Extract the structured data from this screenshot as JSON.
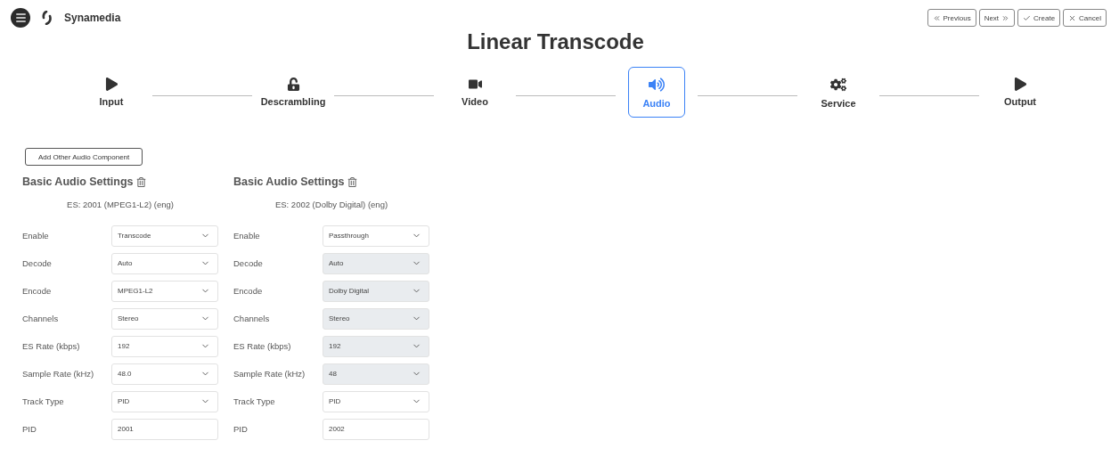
{
  "header": {
    "brand": "Synamedia",
    "buttons": [
      {
        "kind": "previous",
        "label": "Previous"
      },
      {
        "kind": "next",
        "label": "Next"
      },
      {
        "kind": "create",
        "label": "Create"
      },
      {
        "kind": "cancel",
        "label": "Cancel"
      }
    ]
  },
  "title": "Linear Transcode",
  "steps": [
    {
      "kind": "input",
      "label": "Input",
      "selected": false
    },
    {
      "kind": "descrambling",
      "label": "Descrambling",
      "selected": false
    },
    {
      "kind": "video",
      "label": "Video",
      "selected": false
    },
    {
      "kind": "audio",
      "label": "Audio",
      "selected": true
    },
    {
      "kind": "service",
      "label": "Service",
      "selected": false
    },
    {
      "kind": "output",
      "label": "Output",
      "selected": false
    }
  ],
  "add_button": "Add Other Audio Component",
  "components": [
    {
      "title": "Basic Audio Settings",
      "es": "ES: 2001 (MPEG1-L2) (eng)",
      "fields": [
        {
          "label": "Enable",
          "kind": "select",
          "value": "Transcode",
          "disabled": false
        },
        {
          "label": "Decode",
          "kind": "select",
          "value": "Auto",
          "disabled": false
        },
        {
          "label": "Encode",
          "kind": "select",
          "value": "MPEG1-L2",
          "disabled": false
        },
        {
          "label": "Channels",
          "kind": "select",
          "value": "Stereo",
          "disabled": false
        },
        {
          "label": "ES Rate (kbps)",
          "kind": "select",
          "value": "192",
          "disabled": false
        },
        {
          "label": "Sample Rate (kHz)",
          "kind": "select",
          "value": "48.0",
          "disabled": false
        },
        {
          "label": "Track Type",
          "kind": "select",
          "value": "PID",
          "disabled": false
        },
        {
          "label": "PID",
          "kind": "input",
          "value": "2001",
          "disabled": false
        }
      ]
    },
    {
      "title": "Basic Audio Settings",
      "es": "ES: 2002 (Dolby Digital) (eng)",
      "fields": [
        {
          "label": "Enable",
          "kind": "select",
          "value": "Passthrough",
          "disabled": false
        },
        {
          "label": "Decode",
          "kind": "select",
          "value": "Auto",
          "disabled": true
        },
        {
          "label": "Encode",
          "kind": "select",
          "value": "Dolby Digital",
          "disabled": true
        },
        {
          "label": "Channels",
          "kind": "select",
          "value": "Stereo",
          "disabled": true
        },
        {
          "label": "ES Rate (kbps)",
          "kind": "select",
          "value": "192",
          "disabled": true
        },
        {
          "label": "Sample Rate (kHz)",
          "kind": "select",
          "value": "48",
          "disabled": true
        },
        {
          "label": "Track Type",
          "kind": "select",
          "value": "PID",
          "disabled": false
        },
        {
          "label": "PID",
          "kind": "input",
          "value": "2002",
          "disabled": false
        }
      ]
    }
  ]
}
